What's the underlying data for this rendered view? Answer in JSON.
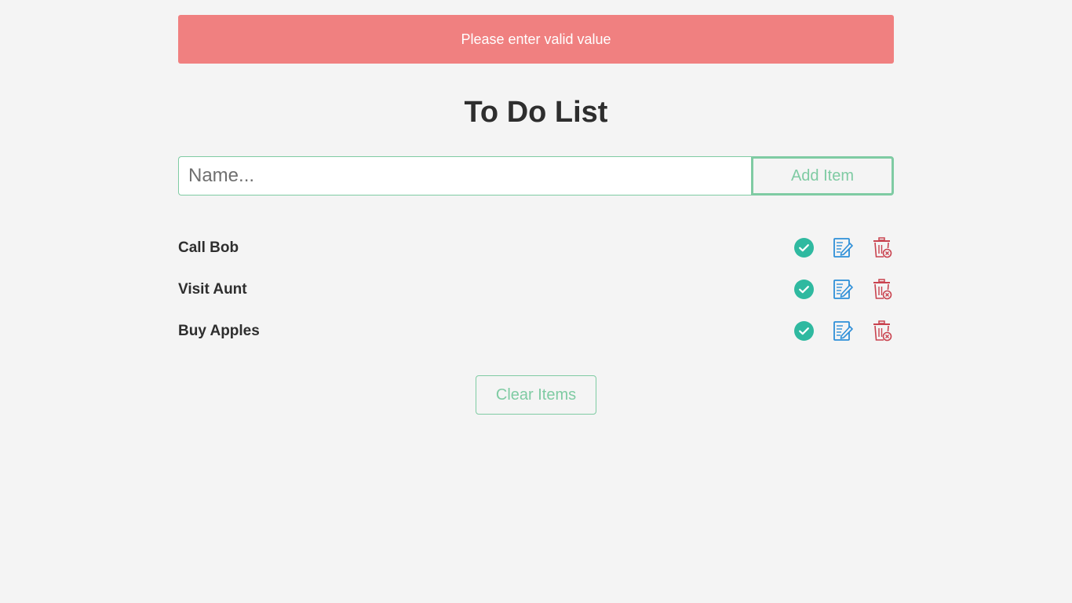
{
  "alert": {
    "message": "Please enter valid value",
    "color": "#f08080"
  },
  "header": {
    "title": "To Do List"
  },
  "form": {
    "input_placeholder": "Name...",
    "input_value": "",
    "add_label": "Add Item"
  },
  "items": [
    {
      "label": "Call Bob"
    },
    {
      "label": "Visit Aunt"
    },
    {
      "label": "Buy Apples"
    }
  ],
  "item_actions": {
    "complete_icon": "check-circle-icon",
    "edit_icon": "edit-document-icon",
    "delete_icon": "trash-icon"
  },
  "footer": {
    "clear_label": "Clear Items"
  },
  "colors": {
    "accent": "#7fcba3",
    "complete": "#2fb9a0",
    "edit": "#2e8fd8",
    "delete": "#c9434f"
  }
}
